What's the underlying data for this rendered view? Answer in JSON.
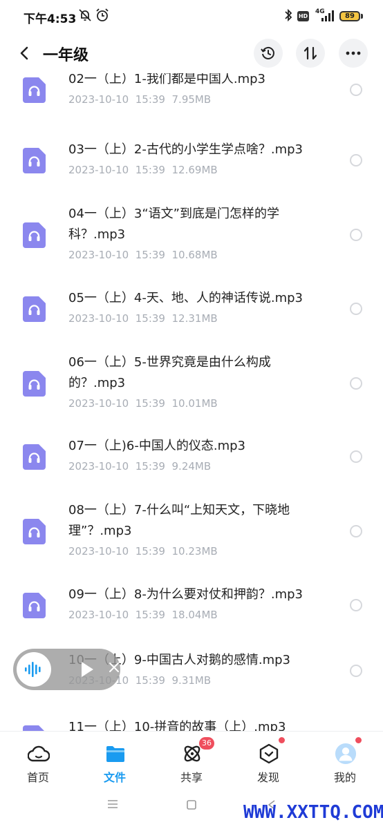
{
  "status_bar": {
    "time": "下午4:53",
    "network": "4G",
    "hd": "HD",
    "battery": "89",
    "icons": [
      "mute-icon",
      "alarm-icon",
      "bluetooth-icon",
      "hd-icon",
      "signal-icon",
      "battery-icon"
    ]
  },
  "header": {
    "back_icon": "back-arrow-icon",
    "title": "一年级",
    "actions": [
      "history-icon",
      "sort-icon",
      "more-icon"
    ]
  },
  "files": [
    {
      "name": "02一（上）1-我们都是中国人.mp3",
      "date": "2023-10-10",
      "time": "15:39",
      "size": "7.95MB"
    },
    {
      "name": "03一（上）2-古代的小学生学点啥？.mp3",
      "date": "2023-10-10",
      "time": "15:39",
      "size": "12.69MB"
    },
    {
      "name": "04一（上）3“语文”到底是门怎样的学科？.mp3",
      "date": "2023-10-10",
      "time": "15:39",
      "size": "10.68MB"
    },
    {
      "name": "05一（上）4-天、地、人的神话传说.mp3",
      "date": "2023-10-10",
      "time": "15:39",
      "size": "12.31MB"
    },
    {
      "name": "06一（上）5-世界究竟是由什么构成的？.mp3",
      "date": "2023-10-10",
      "time": "15:39",
      "size": "10.01MB"
    },
    {
      "name": "07一（上)6-中国人的仪态.mp3",
      "date": "2023-10-10",
      "time": "15:39",
      "size": "9.24MB"
    },
    {
      "name": "08一（上）7-什么叫“上知天文，下晓地理”？.mp3",
      "date": "2023-10-10",
      "time": "15:39",
      "size": "10.23MB"
    },
    {
      "name": "09一（上）8-为什么要对仗和押韵？.mp3",
      "date": "2023-10-10",
      "time": "15:39",
      "size": "18.04MB"
    },
    {
      "name": "10一（上）9-中国古人对鹅的感情.mp3",
      "date": "2023-10-10",
      "time": "15:39",
      "size": "9.31MB"
    },
    {
      "name": "11一（上）10-拼音的故事（上）.mp3",
      "date": "",
      "time": "",
      "size": ""
    }
  ],
  "player": {
    "icons": [
      "audio-wave-icon",
      "play-icon",
      "close-icon"
    ]
  },
  "nav": [
    {
      "label": "首页",
      "icon": "home-cloud-icon",
      "active": false,
      "badge": ""
    },
    {
      "label": "文件",
      "icon": "folder-icon",
      "active": true,
      "badge": ""
    },
    {
      "label": "共享",
      "icon": "share-orbit-icon",
      "active": false,
      "badge": "36"
    },
    {
      "label": "发现",
      "icon": "discover-box-icon",
      "active": false,
      "badge": "dot"
    },
    {
      "label": "我的",
      "icon": "avatar-icon",
      "active": false,
      "badge": "dot"
    }
  ],
  "watermark": "WWW.XXTTQ.COM",
  "colors": {
    "accent": "#1a9bf0",
    "file_icon": "#8b87ee",
    "badge": "#ef4e5d",
    "meta_text": "#a8adb5",
    "watermark": "#1f3bd6"
  }
}
